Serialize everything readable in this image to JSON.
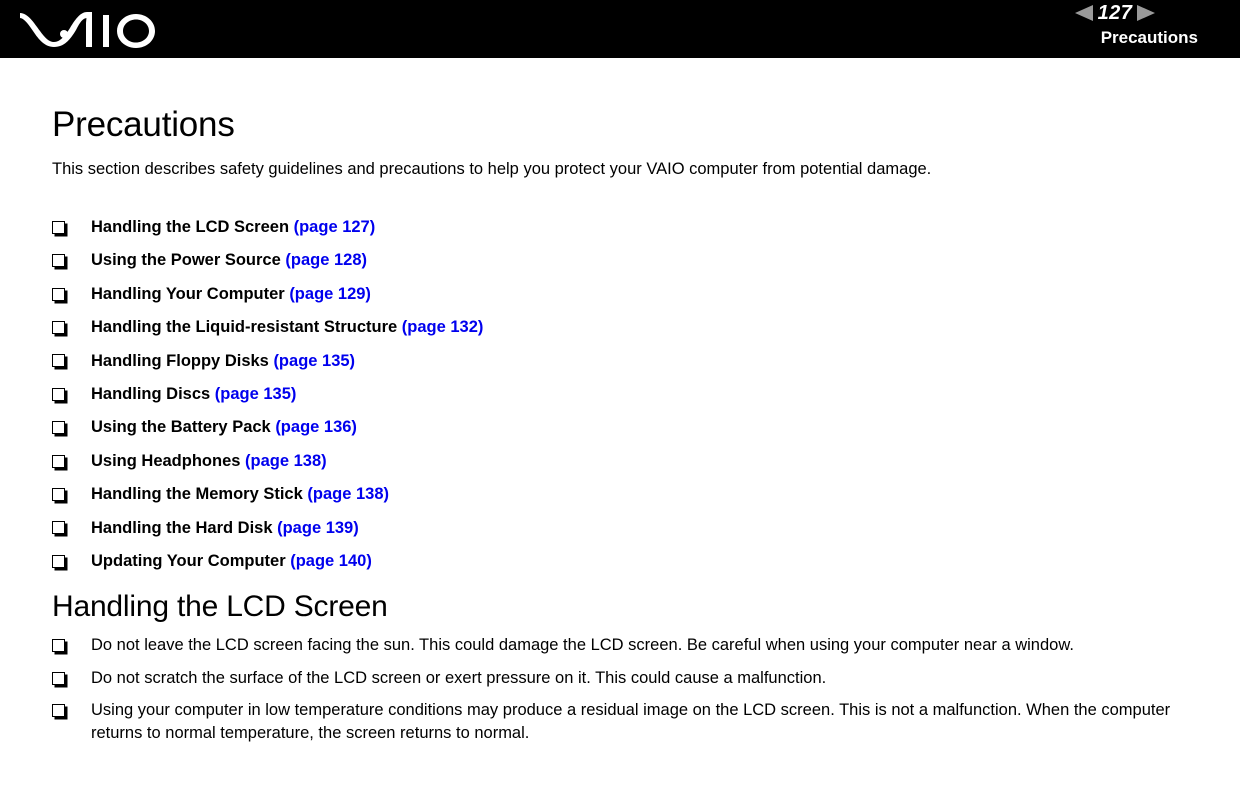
{
  "header": {
    "logo_alt": "VAIO",
    "prev_arrow": "◀",
    "next_arrow": "▶",
    "page_number": "127",
    "section_name": "Precautions"
  },
  "main": {
    "title": "Precautions",
    "intro": "This section describes safety guidelines and precautions to help you protect your VAIO computer from potential damage.",
    "links": [
      {
        "label": "Handling the LCD Screen ",
        "page": "(page 127)"
      },
      {
        "label": "Using the Power Source ",
        "page": "(page 128)"
      },
      {
        "label": "Handling Your Computer ",
        "page": "(page 129)"
      },
      {
        "label": "Handling the Liquid-resistant Structure ",
        "page": "(page 132)"
      },
      {
        "label": "Handling Floppy Disks ",
        "page": "(page 135)"
      },
      {
        "label": "Handling Discs ",
        "page": "(page 135)"
      },
      {
        "label": "Using the Battery Pack ",
        "page": "(page 136)"
      },
      {
        "label": "Using Headphones ",
        "page": "(page 138)"
      },
      {
        "label": "Handling the Memory Stick ",
        "page": "(page 138)"
      },
      {
        "label": "Handling the Hard Disk ",
        "page": "(page 139)"
      },
      {
        "label": "Updating Your Computer ",
        "page": "(page 140)"
      }
    ],
    "subsection_title": "Handling the LCD Screen",
    "notes": [
      "Do not leave the LCD screen facing the sun. This could damage the LCD screen. Be careful when using your computer near a window.",
      "Do not scratch the surface of the LCD screen or exert pressure on it. This could cause a malfunction.",
      "Using your computer in low temperature conditions may produce a residual image on the LCD screen. This is not a malfunction. When the computer returns to normal temperature, the screen returns to normal."
    ]
  },
  "colors": {
    "link": "#0000ee",
    "header_bg": "#000000",
    "arrow": "#9a9a9a",
    "text": "#000000"
  }
}
